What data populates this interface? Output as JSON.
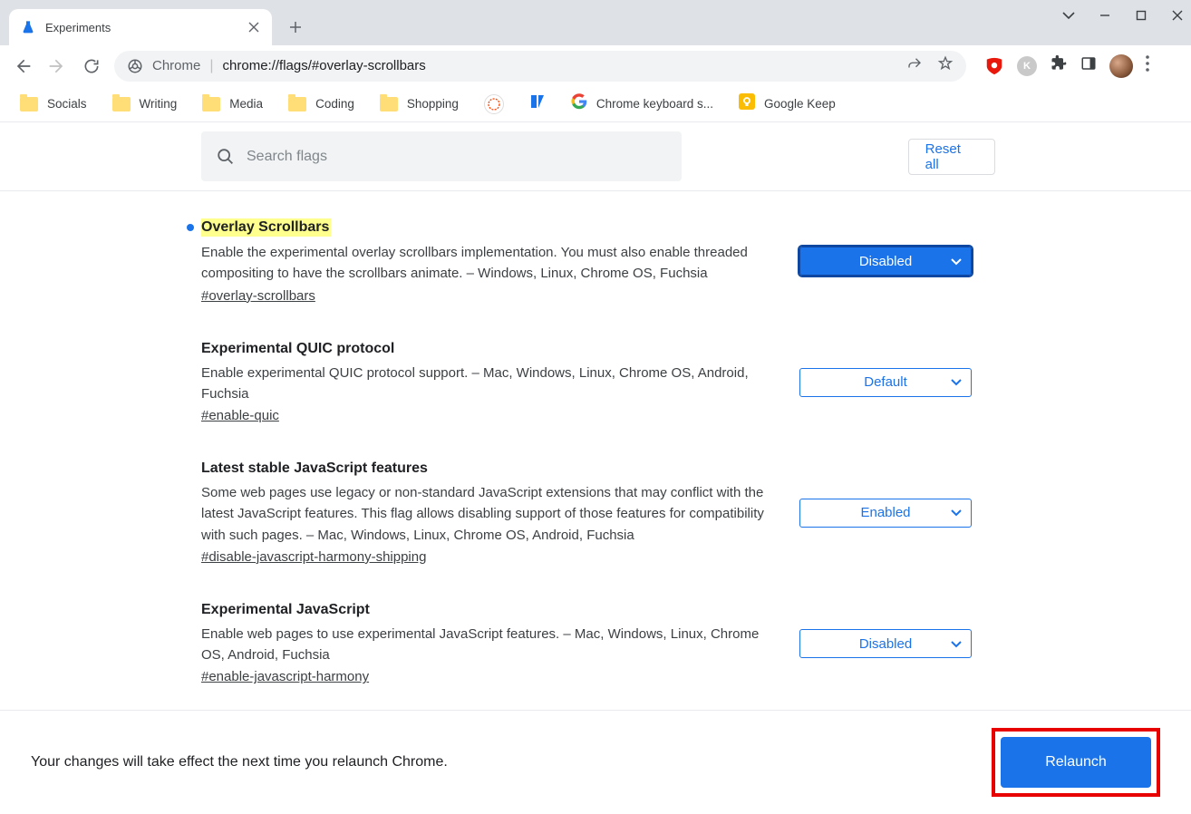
{
  "window": {
    "tab_title": "Experiments",
    "address_prefix": "Chrome",
    "address_url": "chrome://flags/#overlay-scrollbars"
  },
  "bookmarks": [
    {
      "label": "Socials",
      "type": "folder"
    },
    {
      "label": "Writing",
      "type": "folder"
    },
    {
      "label": "Media",
      "type": "folder"
    },
    {
      "label": "Coding",
      "type": "folder"
    },
    {
      "label": "Shopping",
      "type": "folder"
    },
    {
      "label": "",
      "type": "icon-hn"
    },
    {
      "label": "",
      "type": "icon-blue"
    },
    {
      "label": "Chrome keyboard s...",
      "type": "icon-google"
    },
    {
      "label": "Google Keep",
      "type": "icon-keep"
    }
  ],
  "search": {
    "placeholder": "Search flags"
  },
  "reset_label": "Reset all",
  "flags": [
    {
      "title": "Overlay Scrollbars",
      "highlighted": true,
      "modified": true,
      "description": "Enable the experimental overlay scrollbars implementation. You must also enable threaded compositing to have the scrollbars animate. – Windows, Linux, Chrome OS, Fuchsia",
      "anchor": "#overlay-scrollbars",
      "selected": "Disabled",
      "active_select": true
    },
    {
      "title": "Experimental QUIC protocol",
      "highlighted": false,
      "modified": false,
      "description": "Enable experimental QUIC protocol support. – Mac, Windows, Linux, Chrome OS, Android, Fuchsia",
      "anchor": "#enable-quic",
      "selected": "Default",
      "active_select": false
    },
    {
      "title": "Latest stable JavaScript features",
      "highlighted": false,
      "modified": false,
      "description": "Some web pages use legacy or non-standard JavaScript extensions that may conflict with the latest JavaScript features. This flag allows disabling support of those features for compatibility with such pages. – Mac, Windows, Linux, Chrome OS, Android, Fuchsia",
      "anchor": "#disable-javascript-harmony-shipping",
      "selected": "Enabled",
      "active_select": false
    },
    {
      "title": "Experimental JavaScript",
      "highlighted": false,
      "modified": false,
      "description": "Enable web pages to use experimental JavaScript features. – Mac, Windows, Linux, Chrome OS, Android, Fuchsia",
      "anchor": "#enable-javascript-harmony",
      "selected": "Disabled",
      "active_select": false
    }
  ],
  "footer": {
    "message": "Your changes will take effect the next time you relaunch Chrome.",
    "button": "Relaunch"
  }
}
